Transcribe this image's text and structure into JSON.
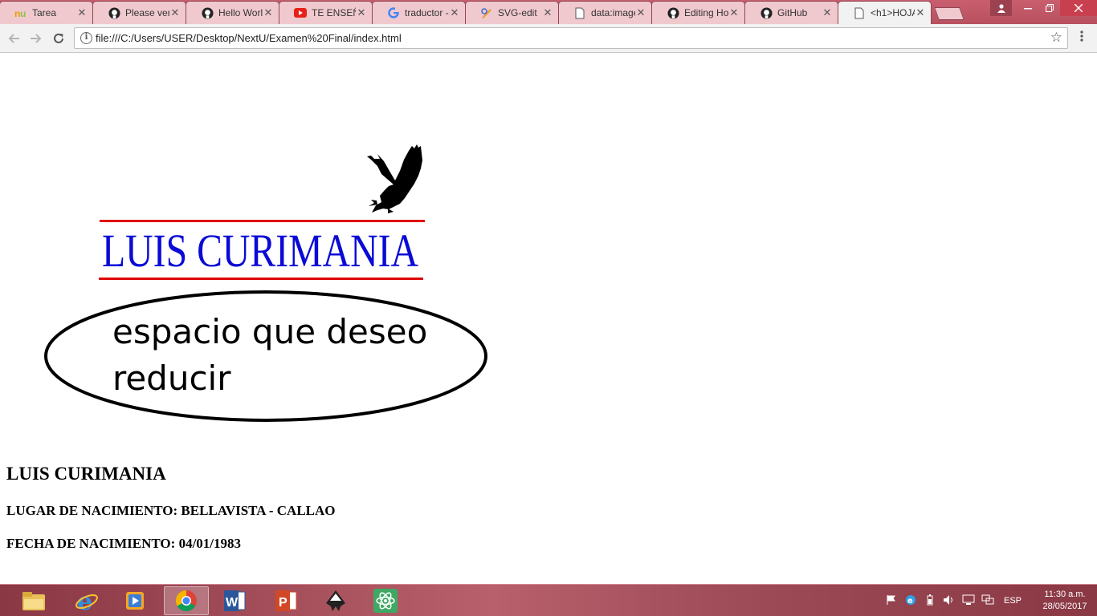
{
  "browser": {
    "tabs": [
      {
        "title": "Tarea",
        "icon": "nextu-icon",
        "active": false
      },
      {
        "title": "Please veri",
        "icon": "github-icon",
        "active": false
      },
      {
        "title": "Hello Worl",
        "icon": "github-icon",
        "active": false
      },
      {
        "title": "TE ENSEÑ",
        "icon": "youtube-icon",
        "active": false
      },
      {
        "title": "traductor -",
        "icon": "google-icon",
        "active": false
      },
      {
        "title": "SVG-edit",
        "icon": "svgedit-icon",
        "active": false
      },
      {
        "title": "data:image",
        "icon": "document-icon",
        "active": false
      },
      {
        "title": "Editing Ho",
        "icon": "github-icon",
        "active": false
      },
      {
        "title": "GitHub",
        "icon": "github-icon",
        "active": false
      },
      {
        "title": "<h1>HOJA",
        "icon": "document-icon",
        "active": true
      }
    ],
    "close_glyph": "✕",
    "url": "file:///C:/Users/USER/Desktop/NextU/Examen%20Final/index.html"
  },
  "page": {
    "logo_text": "LUIS CURIMANIA",
    "bubble_text": "espacio que deseo reducir",
    "name": "LUIS CURIMANIA",
    "birthplace": "LUGAR DE NACIMIENTO: BELLAVISTA - CALLAO",
    "birthdate": "FECHA DE NACIMIENTO: 04/01/1983"
  },
  "taskbar": {
    "apps": [
      "file-explorer-icon",
      "internet-explorer-icon",
      "media-player-icon",
      "chrome-icon",
      "word-icon",
      "powerpoint-icon",
      "inkscape-icon",
      "atom-icon"
    ],
    "active_app": "chrome-icon",
    "language": "ESP",
    "time": "11:30 a.m.",
    "date": "28/05/2017"
  },
  "colors": {
    "logo_blue": "#0a0ad6",
    "logo_red": "#e00000",
    "tab_bar": "#c95f6e"
  }
}
